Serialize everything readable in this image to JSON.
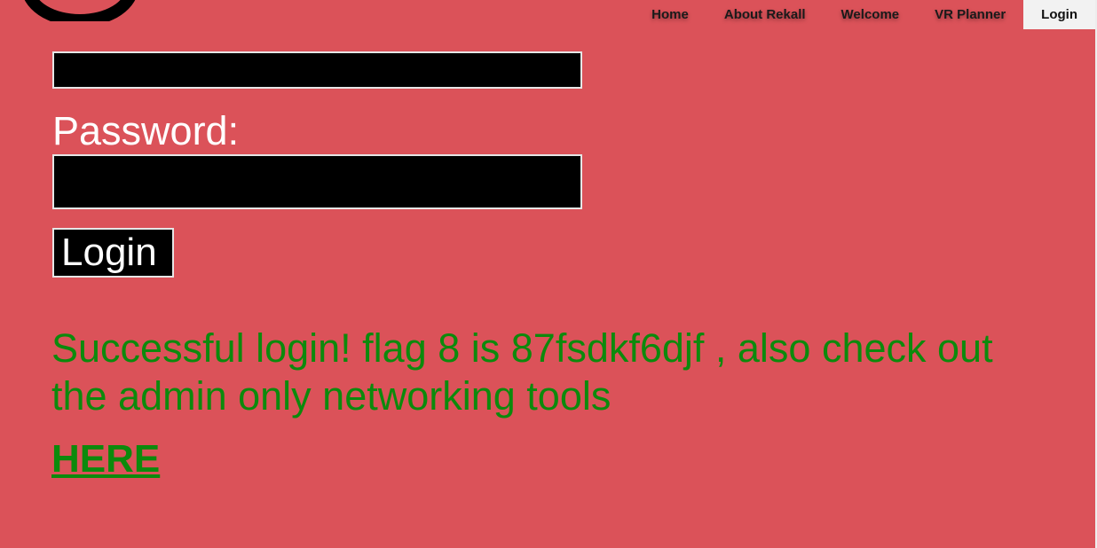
{
  "nav": {
    "items": [
      {
        "label": "Home",
        "active": false
      },
      {
        "label": "About Rekall",
        "active": false
      },
      {
        "label": "Welcome",
        "active": false
      },
      {
        "label": "VR Planner",
        "active": false
      },
      {
        "label": "Login",
        "active": true
      }
    ]
  },
  "form": {
    "username_value": "",
    "password_label": "Password:",
    "password_value": "",
    "login_button_label": "Login"
  },
  "message": {
    "text": "Successful login! flag 8 is 87fsdkf6djf , also check out the admin only networking tools",
    "link_text": "HERE"
  },
  "colors": {
    "background": "#db5259",
    "message_green": "#0c8a0c",
    "input_background": "#000000"
  }
}
